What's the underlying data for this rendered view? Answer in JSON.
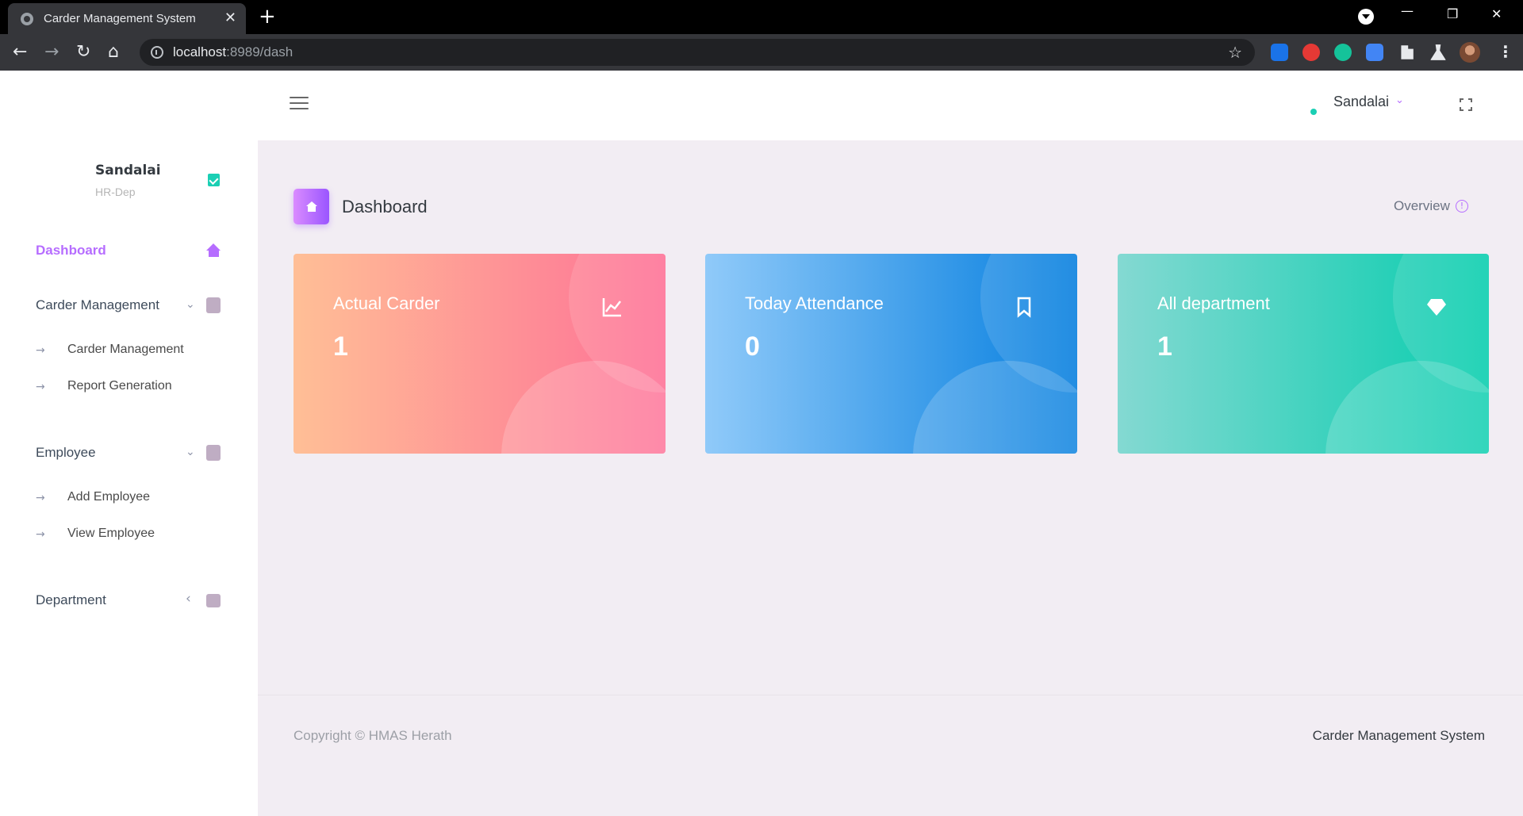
{
  "browser": {
    "tab_title": "Carder Management System",
    "url_host": "localhost",
    "url_rest": ":8989/dash"
  },
  "topnav": {
    "user_name": "Sandalai"
  },
  "sidebar": {
    "profile_name": "Sandalai",
    "profile_role": "HR-Dep",
    "items": [
      {
        "label": "Dashboard",
        "active": true,
        "icon": "home-icon"
      },
      {
        "label": "Carder Management",
        "icon": "contact-card-icon",
        "sub": [
          "Carder Management",
          "Report Generation"
        ]
      },
      {
        "label": "Employee",
        "icon": "contact-card-icon",
        "sub": [
          "Add Employee",
          "View Employee"
        ]
      },
      {
        "label": "Department",
        "icon": "medical-bag-icon"
      }
    ]
  },
  "page": {
    "title": "Dashboard",
    "overview": "Overview"
  },
  "cards": [
    {
      "title": "Actual Carder",
      "value": "1",
      "icon": "chart-line-icon",
      "gradient_from": "#ffbf96",
      "gradient_to": "#fe7096"
    },
    {
      "title": "Today Attendance",
      "value": "0",
      "icon": "bookmark-icon",
      "gradient_from": "#90caf9",
      "gradient_to": "#047edf"
    },
    {
      "title": "All department",
      "value": "1",
      "icon": "diamond-icon",
      "gradient_from": "#84d9d2",
      "gradient_to": "#07cdae"
    }
  ],
  "footer": {
    "copyright": "Copyright © HMAS Herath",
    "app_name": "Carder Management System"
  },
  "colors": {
    "accent": "#b66dff",
    "online": "#1bcfb4",
    "page_bg": "#f2edf3"
  }
}
